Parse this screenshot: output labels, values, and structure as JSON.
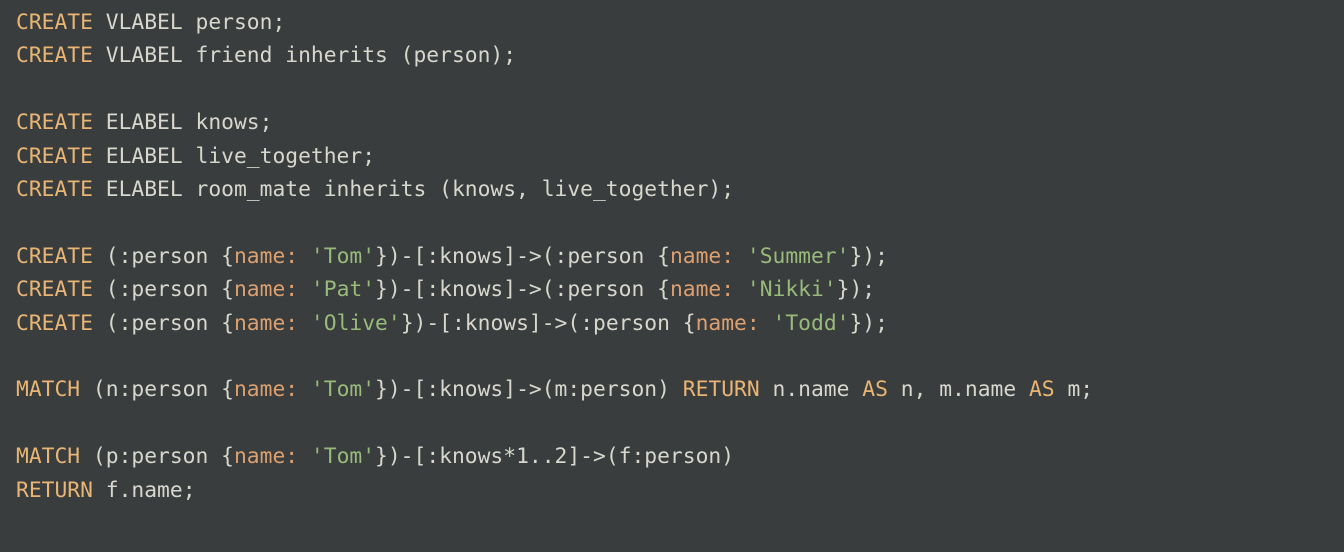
{
  "code": {
    "lines": [
      {
        "tokens": [
          {
            "cls": "kw",
            "t": "CREATE"
          },
          {
            "cls": "id",
            "t": " VLABEL person;"
          }
        ]
      },
      {
        "tokens": [
          {
            "cls": "kw",
            "t": "CREATE"
          },
          {
            "cls": "id",
            "t": " VLABEL friend inherits (person);"
          }
        ]
      },
      {
        "tokens": []
      },
      {
        "tokens": [
          {
            "cls": "kw",
            "t": "CREATE"
          },
          {
            "cls": "id",
            "t": " ELABEL knows;"
          }
        ]
      },
      {
        "tokens": [
          {
            "cls": "kw",
            "t": "CREATE"
          },
          {
            "cls": "id",
            "t": " ELABEL live_together;"
          }
        ]
      },
      {
        "tokens": [
          {
            "cls": "kw",
            "t": "CREATE"
          },
          {
            "cls": "id",
            "t": " ELABEL room_mate inherits (knows, live_together);"
          }
        ]
      },
      {
        "tokens": []
      },
      {
        "tokens": [
          {
            "cls": "kw",
            "t": "CREATE"
          },
          {
            "cls": "id",
            "t": " (:person {"
          },
          {
            "cls": "attr",
            "t": "name:"
          },
          {
            "cls": "id",
            "t": " "
          },
          {
            "cls": "str",
            "t": "'Tom'"
          },
          {
            "cls": "id",
            "t": "})-[:knows]->(:person {"
          },
          {
            "cls": "attr",
            "t": "name:"
          },
          {
            "cls": "id",
            "t": " "
          },
          {
            "cls": "str",
            "t": "'Summer'"
          },
          {
            "cls": "id",
            "t": "});"
          }
        ]
      },
      {
        "tokens": [
          {
            "cls": "kw",
            "t": "CREATE"
          },
          {
            "cls": "id",
            "t": " (:person {"
          },
          {
            "cls": "attr",
            "t": "name:"
          },
          {
            "cls": "id",
            "t": " "
          },
          {
            "cls": "str",
            "t": "'Pat'"
          },
          {
            "cls": "id",
            "t": "})-[:knows]->(:person {"
          },
          {
            "cls": "attr",
            "t": "name:"
          },
          {
            "cls": "id",
            "t": " "
          },
          {
            "cls": "str",
            "t": "'Nikki'"
          },
          {
            "cls": "id",
            "t": "});"
          }
        ]
      },
      {
        "tokens": [
          {
            "cls": "kw",
            "t": "CREATE"
          },
          {
            "cls": "id",
            "t": " (:person {"
          },
          {
            "cls": "attr",
            "t": "name:"
          },
          {
            "cls": "id",
            "t": " "
          },
          {
            "cls": "str",
            "t": "'Olive'"
          },
          {
            "cls": "id",
            "t": "})-[:knows]->(:person {"
          },
          {
            "cls": "attr",
            "t": "name:"
          },
          {
            "cls": "id",
            "t": " "
          },
          {
            "cls": "str",
            "t": "'Todd'"
          },
          {
            "cls": "id",
            "t": "});"
          }
        ]
      },
      {
        "tokens": []
      },
      {
        "tokens": [
          {
            "cls": "kw",
            "t": "MATCH"
          },
          {
            "cls": "id",
            "t": " (n:person {"
          },
          {
            "cls": "attr",
            "t": "name:"
          },
          {
            "cls": "id",
            "t": " "
          },
          {
            "cls": "str",
            "t": "'Tom'"
          },
          {
            "cls": "id",
            "t": "})-[:knows]->(m:person) "
          },
          {
            "cls": "kw",
            "t": "RETURN"
          },
          {
            "cls": "id",
            "t": " n.name "
          },
          {
            "cls": "kw",
            "t": "AS"
          },
          {
            "cls": "id",
            "t": " n, m.name "
          },
          {
            "cls": "kw",
            "t": "AS"
          },
          {
            "cls": "id",
            "t": " m;"
          }
        ]
      },
      {
        "tokens": []
      },
      {
        "tokens": [
          {
            "cls": "kw",
            "t": "MATCH"
          },
          {
            "cls": "id",
            "t": " (p:person {"
          },
          {
            "cls": "attr",
            "t": "name:"
          },
          {
            "cls": "id",
            "t": " "
          },
          {
            "cls": "str",
            "t": "'Tom'"
          },
          {
            "cls": "id",
            "t": "})-[:knows*1..2]->(f:person)"
          }
        ]
      },
      {
        "tokens": [
          {
            "cls": "kw",
            "t": "RETURN"
          },
          {
            "cls": "id",
            "t": " f.name;"
          }
        ]
      }
    ]
  }
}
